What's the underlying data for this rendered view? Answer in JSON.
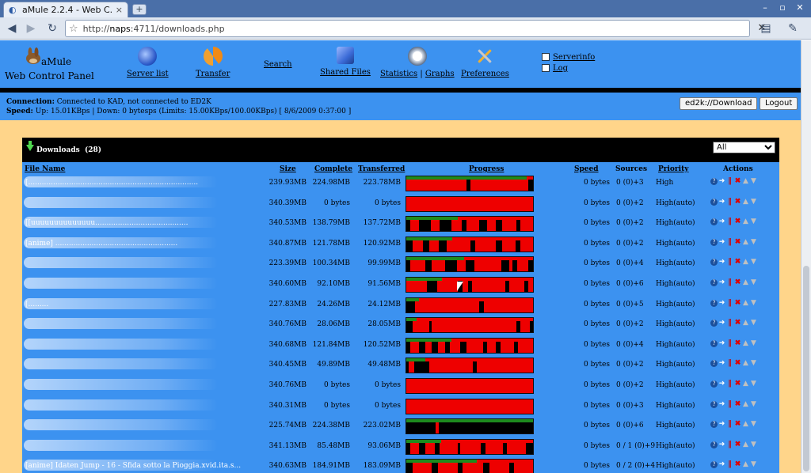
{
  "browser": {
    "tab_title": "aMule 2.2.4 - Web C...",
    "tab_close": "×",
    "new_tab": "+",
    "url_host": "naps",
    "url_prefix": "http://",
    "url_rest": ":4711/downloads.php",
    "stop": "✕"
  },
  "header": {
    "logo_line1": "aMule",
    "logo_line2": "Web Control Panel",
    "nav": [
      {
        "label": "Server list",
        "icon": "globe-icon",
        "color": "#2a57c7"
      },
      {
        "label": "Transfer",
        "icon": "transfer-icon",
        "color": "#f08a16"
      },
      {
        "label": "Search",
        "icon": "search-icon",
        "color": ""
      },
      {
        "label": "Shared Files",
        "icon": "shared-files-icon",
        "color": "#3a6ad6"
      },
      {
        "label": "Statistics",
        "icon": "statistics-icon",
        "color": "#dbe3ee"
      },
      {
        "label": "Graphs",
        "icon": "graphs-icon",
        "color": ""
      },
      {
        "label": "Preferences",
        "icon": "tools-icon",
        "color": "#f0b030"
      }
    ],
    "side": [
      {
        "label": "Serverinfo",
        "icon": "serverinfo-icon"
      },
      {
        "label": "Log",
        "icon": "log-icon"
      }
    ]
  },
  "status": {
    "connection_label": "Connection:",
    "connection_text": "Connected to KAD, not connected to ED2K",
    "speed_label": "Speed:",
    "speed_text": "Up: 15.01KBps | Down: 0 bytesps (Limits: 15.00KBps/100.00KBps)",
    "timestamp": "[ 8/6/2009 0:37:00 ]",
    "ed2k_button": "ed2k://Download",
    "logout_button": "Logout"
  },
  "downloads": {
    "title": "Downloads",
    "count": "(28)",
    "filter": "All",
    "columns": {
      "file_name": "File Name",
      "size": "Size",
      "complete": "Complete",
      "transferred": "Transferred",
      "progress": "Progress",
      "speed": "Speed",
      "sources": "Sources",
      "priority": "Priority",
      "actions": "Actions"
    },
    "rows": [
      {
        "name": "[...........................................................................",
        "size": "239.93MB",
        "complete": "224.98MB",
        "transferred": "223.78MB",
        "progress": 0.94,
        "speed": "0 bytes",
        "sources": "0 (0)+3",
        "priority": "High",
        "segments": [
          [
            0.47,
            0.03
          ],
          [
            0.95,
            0.04
          ]
        ]
      },
      {
        "name": "",
        "size": "340.39MB",
        "complete": "0 bytes",
        "transferred": "0 bytes",
        "progress": 0.0,
        "speed": "0 bytes",
        "sources": "0 (0)+2",
        "priority": "High(auto)",
        "segments": []
      },
      {
        "name": "[[uuuuuuuuuuuuuu.........................................",
        "size": "340.53MB",
        "complete": "138.79MB",
        "transferred": "137.72MB",
        "progress": 0.4,
        "speed": "0 bytes",
        "sources": "0 (0)+2",
        "priority": "High(auto)",
        "segments": [
          [
            0.0,
            0.03
          ],
          [
            0.1,
            0.09
          ],
          [
            0.26,
            0.09
          ],
          [
            0.43,
            0.04
          ],
          [
            0.57,
            0.06
          ],
          [
            0.7,
            0.05
          ],
          [
            0.86,
            0.03
          ]
        ]
      },
      {
        "name": "[anime] ......................................................",
        "size": "340.87MB",
        "complete": "121.78MB",
        "transferred": "120.92MB",
        "progress": 0.36,
        "speed": "0 bytes",
        "sources": "0 (0)+2",
        "priority": "High(auto)",
        "segments": [
          [
            0.0,
            0.05
          ],
          [
            0.13,
            0.05
          ],
          [
            0.25,
            0.06
          ],
          [
            0.5,
            0.04
          ],
          [
            0.7,
            0.05
          ],
          [
            0.85,
            0.04
          ]
        ]
      },
      {
        "name": "",
        "size": "223.39MB",
        "complete": "100.34MB",
        "transferred": "99.99MB",
        "progress": 0.45,
        "speed": "0 bytes",
        "sources": "0 (0)+4",
        "priority": "High(auto)",
        "segments": [
          [
            0.0,
            0.03
          ],
          [
            0.15,
            0.05
          ],
          [
            0.3,
            0.09
          ],
          [
            0.46,
            0.07
          ],
          [
            0.74,
            0.06
          ],
          [
            0.83,
            0.04
          ],
          [
            0.95,
            0.05
          ]
        ]
      },
      {
        "name": "",
        "size": "340.60MB",
        "complete": "92.10MB",
        "transferred": "91.56MB",
        "progress": 0.28,
        "speed": "0 bytes",
        "sources": "0 (0)+6",
        "priority": "High(auto)",
        "segments": [
          [
            0.16,
            0.08
          ],
          [
            0.4,
            0.04
          ],
          [
            0.48,
            0.03
          ],
          [
            0.77,
            0.03
          ],
          [
            0.92,
            0.03
          ]
        ]
      },
      {
        "name": "[.........",
        "size": "227.83MB",
        "complete": "24.26MB",
        "transferred": "24.12MB",
        "progress": 0.1,
        "speed": "0 bytes",
        "sources": "0 (0)+5",
        "priority": "High(auto)",
        "segments": [
          [
            0.0,
            0.07
          ],
          [
            0.57,
            0.04
          ]
        ]
      },
      {
        "name": "",
        "size": "340.76MB",
        "complete": "28.06MB",
        "transferred": "28.05MB",
        "progress": 0.08,
        "speed": "0 bytes",
        "sources": "0 (0)+2",
        "priority": "High(auto)",
        "segments": [
          [
            0.0,
            0.05
          ],
          [
            0.18,
            0.02
          ],
          [
            0.86,
            0.03
          ],
          [
            0.96,
            0.04
          ]
        ]
      },
      {
        "name": "",
        "size": "340.68MB",
        "complete": "121.84MB",
        "transferred": "120.52MB",
        "progress": 0.35,
        "speed": "0 bytes",
        "sources": "0 (0)+4",
        "priority": "High(auto)",
        "segments": [
          [
            0.0,
            0.03
          ],
          [
            0.1,
            0.05
          ],
          [
            0.2,
            0.05
          ],
          [
            0.3,
            0.04
          ],
          [
            0.42,
            0.05
          ],
          [
            0.6,
            0.03
          ],
          [
            0.7,
            0.04
          ],
          [
            0.84,
            0.03
          ]
        ]
      },
      {
        "name": "",
        "size": "340.45MB",
        "complete": "49.89MB",
        "transferred": "49.48MB",
        "progress": 0.15,
        "speed": "0 bytes",
        "sources": "0 (0)+2",
        "priority": "High(auto)",
        "segments": [
          [
            0.0,
            0.02
          ],
          [
            0.06,
            0.12
          ],
          [
            0.52,
            0.03
          ]
        ]
      },
      {
        "name": "",
        "size": "340.76MB",
        "complete": "0 bytes",
        "transferred": "0 bytes",
        "progress": 0.0,
        "speed": "0 bytes",
        "sources": "0 (0)+2",
        "priority": "High(auto)",
        "segments": []
      },
      {
        "name": "",
        "size": "340.31MB",
        "complete": "0 bytes",
        "transferred": "0 bytes",
        "progress": 0.0,
        "speed": "0 bytes",
        "sources": "0 (0)+3",
        "priority": "High(auto)",
        "segments": []
      },
      {
        "name": "",
        "size": "225.74MB",
        "complete": "224.38MB",
        "transferred": "223.02MB",
        "progress": 0.99,
        "speed": "0 bytes",
        "sources": "0 (0)+6",
        "priority": "High(auto)",
        "segments": [
          [
            0.0,
            0.23
          ],
          [
            0.25,
            0.75
          ]
        ]
      },
      {
        "name": "",
        "size": "341.13MB",
        "complete": "85.48MB",
        "transferred": "93.06MB",
        "progress": 0.27,
        "speed": "0 bytes",
        "sources": "0 / 1 (0)+9",
        "priority": "High(auto)",
        "segments": [
          [
            0.0,
            0.03
          ],
          [
            0.1,
            0.05
          ],
          [
            0.22,
            0.04
          ],
          [
            0.4,
            0.02
          ],
          [
            0.58,
            0.04
          ],
          [
            0.75,
            0.03
          ],
          [
            0.93,
            0.07
          ]
        ]
      },
      {
        "name": "[anime] Idaten Jump - 16 - Sfida sotto la Pioggia.xvid.ita.s...",
        "size": "340.63MB",
        "complete": "184.91MB",
        "transferred": "183.09MB",
        "progress": 0.55,
        "speed": "0 bytes",
        "sources": "0 / 2 (0)+4",
        "priority": "High(auto)",
        "segments": [
          [
            0.0,
            0.05
          ],
          [
            0.2,
            0.05
          ],
          [
            0.4,
            0.04
          ],
          [
            0.6,
            0.05
          ],
          [
            0.8,
            0.04
          ]
        ]
      }
    ]
  }
}
